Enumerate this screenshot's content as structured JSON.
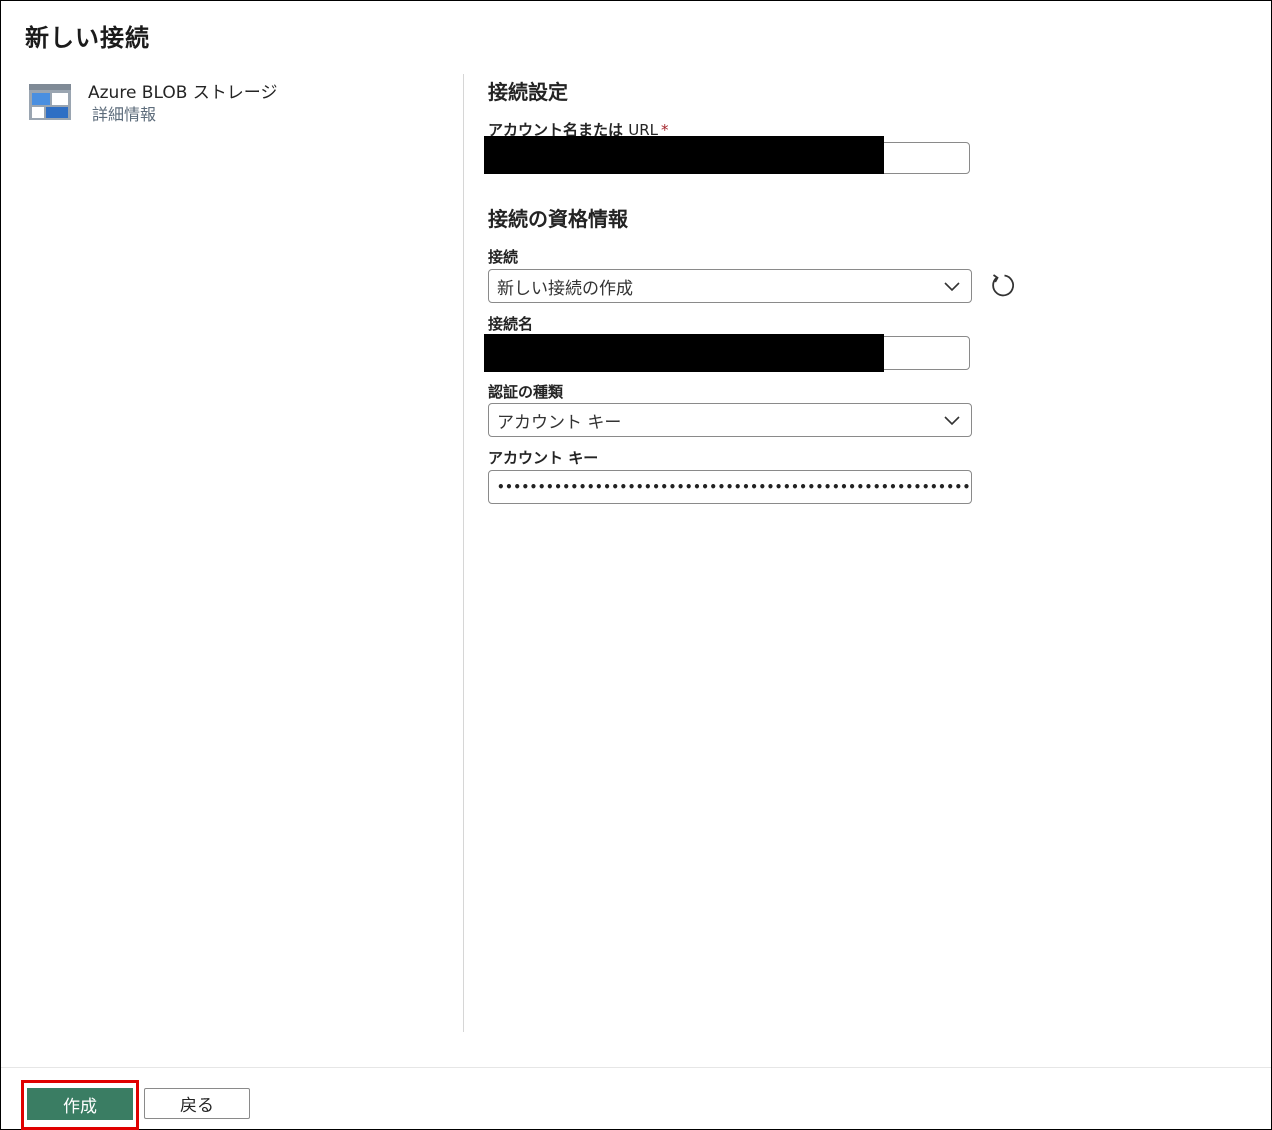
{
  "dialog": {
    "title": "新しい接続"
  },
  "connector": {
    "name": "Azure BLOB ストレージ",
    "details_link": "詳細情報"
  },
  "settings": {
    "section_title": "接続設定",
    "account_label": "アカウント名または",
    "account_label_url": "URL",
    "required_marker": "*"
  },
  "credentials": {
    "section_title": "接続の資格情報",
    "connection_label": "接続",
    "connection_value": "新しい接続の作成",
    "connection_name_label": "接続名",
    "auth_type_label": "認証の種類",
    "auth_type_value": "アカウント キー",
    "account_key_label": "アカウント キー",
    "account_key_value": "•••••••••••••••••••••••••••••••••••••••••••••••••••••••••••••••..."
  },
  "footer": {
    "create_label": "作成",
    "back_label": "戻る"
  },
  "colors": {
    "primary": "#3a7d63",
    "highlight": "#e00000",
    "redaction": "#000000"
  },
  "icons": {
    "connector": "azure-blob-storage-icon",
    "refresh": "refresh-icon",
    "chevron": "chevron-down-icon"
  }
}
